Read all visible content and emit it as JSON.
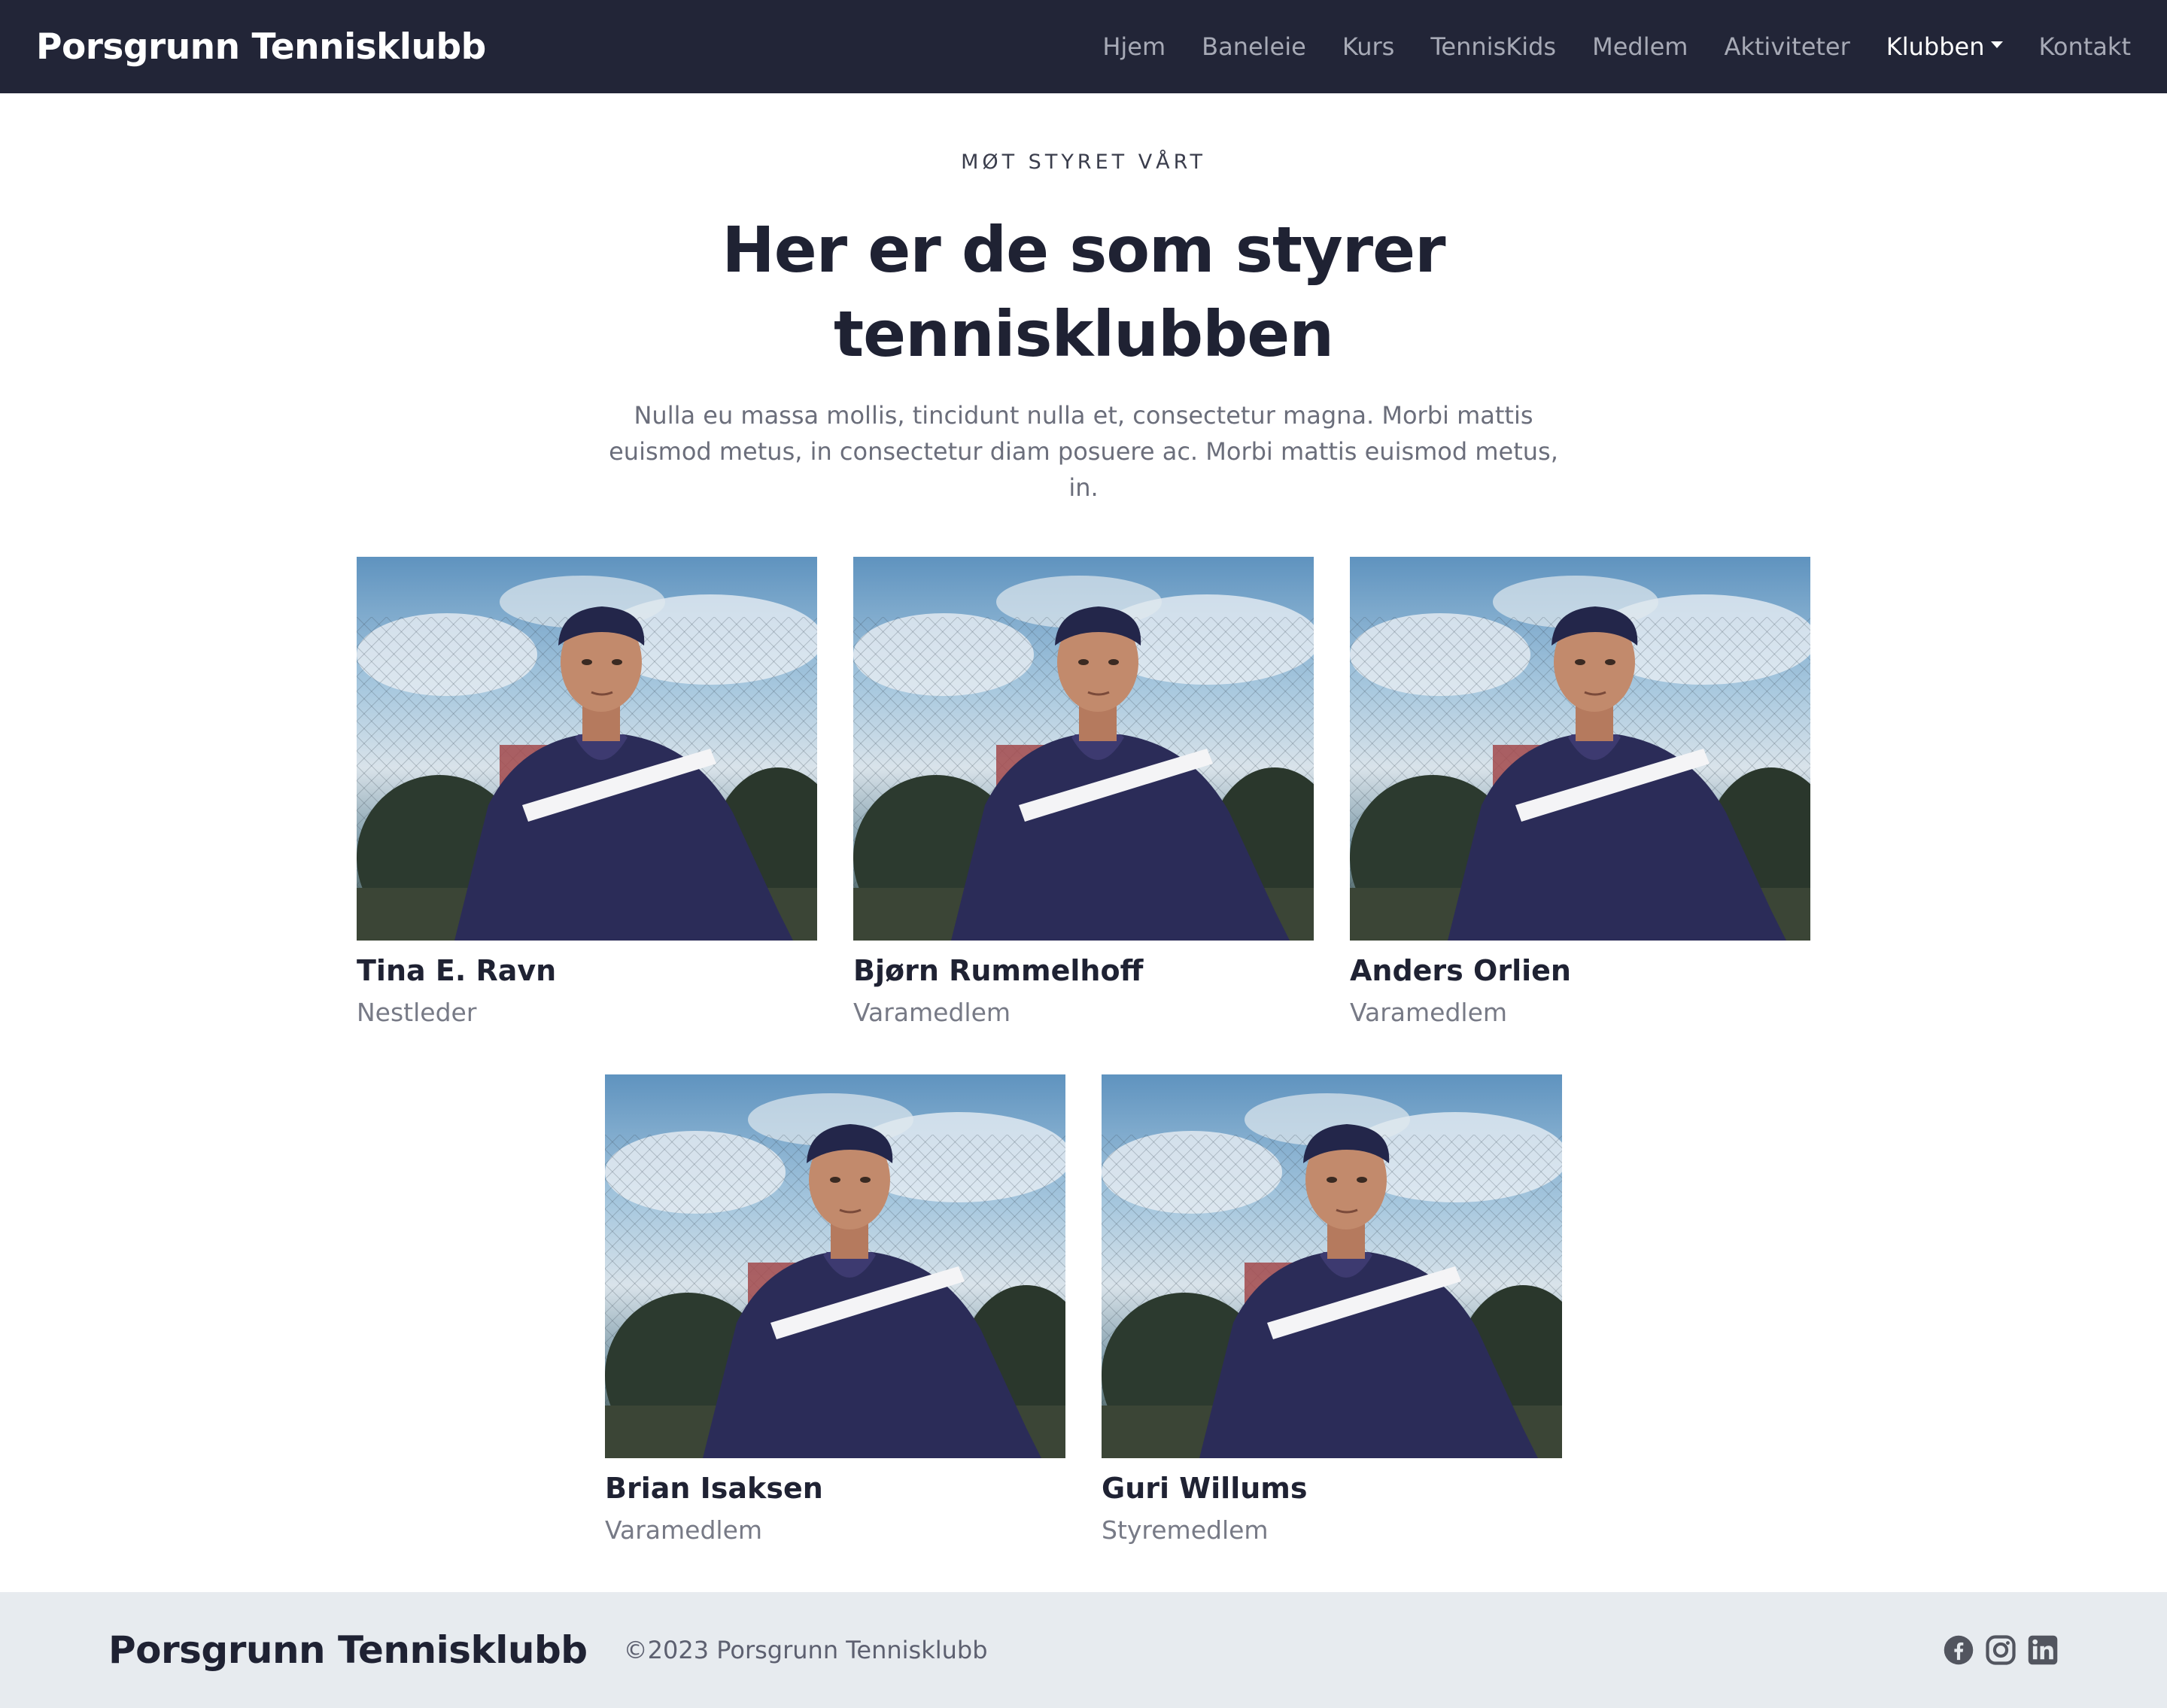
{
  "nav": {
    "brand": "Porsgrunn Tennisklubb",
    "links": [
      {
        "label": "Hjem"
      },
      {
        "label": "Baneleie"
      },
      {
        "label": "Kurs"
      },
      {
        "label": "TennisKids"
      },
      {
        "label": "Medlem"
      },
      {
        "label": "Aktiviteter"
      },
      {
        "label": "Klubben",
        "active": true,
        "dropdown": true
      },
      {
        "label": "Kontakt"
      }
    ]
  },
  "header": {
    "eyebrow": "MØT STYRET VÅRT",
    "title_line1": "Her er de som styrer",
    "title_line2": "tennisklubben",
    "lead": "Nulla eu massa mollis, tincidunt nulla et, consectetur magna. Morbi mattis euismod metus, in consectetur diam posuere ac. Morbi mattis euismod metus, in."
  },
  "members": [
    {
      "name": "Tina E. Ravn",
      "role": "Nestleder"
    },
    {
      "name": "Bjørn Rummelhoff",
      "role": "Varamedlem"
    },
    {
      "name": "Anders Orlien",
      "role": "Varamedlem"
    },
    {
      "name": "Brian Isaksen",
      "role": "Varamedlem"
    },
    {
      "name": "Guri Willums",
      "role": "Styremedlem"
    }
  ],
  "footer": {
    "brand": "Porsgrunn Tennisklubb",
    "copyright": "©2023 Porsgrunn Tennisklubb",
    "social": [
      "facebook-icon",
      "instagram-icon",
      "linkedin-icon"
    ]
  },
  "colors": {
    "navbar_bg": "#222537",
    "text_dark": "#1f2233",
    "text_muted": "#777a86",
    "footer_bg": "#e7ebef"
  }
}
